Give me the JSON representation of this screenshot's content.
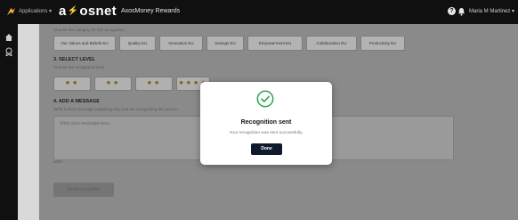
{
  "topbar": {
    "apps_label": "Applications ▾",
    "brand_left": "a",
    "brand_accent": "⚡",
    "brand_right": "osnet",
    "product": "AxosMoney Rewards",
    "help": "?",
    "user": "Maria M Martinez ▾"
  },
  "sidebar": {
    "items": [
      {
        "icon": "home-icon"
      },
      {
        "icon": "award-icon"
      }
    ]
  },
  "category": {
    "hint": "Choose the category for this recognition.",
    "chips": [
      "Our Values and Beliefs EU",
      "Quality EU",
      "Innovation EU",
      "Savings EU",
      "Empowerment EU",
      "Collaboration EU",
      "Productivity EU"
    ]
  },
  "level": {
    "title": "3. SELECT LEVEL",
    "hint": "Choose the recognition level.",
    "options": [
      "★★",
      "★★",
      "★★",
      "★★★★"
    ]
  },
  "message": {
    "title": "4. ADD A MESSAGE",
    "hint": "Write a short message explaining why you are recognizing this person.",
    "placeholder": "Write your message here...",
    "footer": "enter"
  },
  "send": {
    "label": "Send recognition"
  },
  "modal": {
    "title": "Recognition sent",
    "message": "Your recognition was sent successfully.",
    "button": "Done"
  },
  "colors": {
    "check": "#2ea44f",
    "done_bg": "#0f1b2c",
    "brand_accent": "#f3b23c"
  }
}
